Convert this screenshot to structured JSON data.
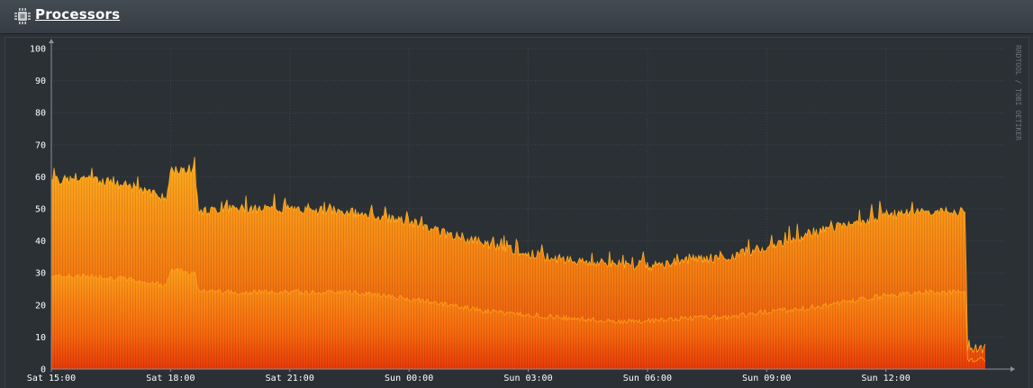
{
  "header": {
    "title": "Processors",
    "icon": "cpu-chip-icon"
  },
  "colors": {
    "background": "#2b3035",
    "band_low": "#ffa31a",
    "band_mid": "#f07010",
    "band_base": "#e8400a",
    "edge": "#ffb020",
    "axis_text": "#ffffff",
    "watermark": "#6b727a"
  },
  "chart_data": {
    "type": "area",
    "watermark": "RRDTOOL / TOBI OETIKER",
    "ylim": [
      0,
      100
    ],
    "yticks": [
      0,
      10,
      20,
      30,
      40,
      50,
      60,
      70,
      80,
      90,
      100
    ],
    "xtick_labels": [
      "Sat 15:00",
      "Sat 18:00",
      "Sat 21:00",
      "Sun 00:00",
      "Sun 03:00",
      "Sun 06:00",
      "Sun 09:00",
      "Sun 12:00"
    ],
    "x_hours": [
      0,
      3,
      6,
      9,
      12,
      15,
      18,
      21
    ],
    "xlim_hours": [
      0,
      24
    ],
    "series_total": {
      "x": [
        0,
        1.0,
        2.0,
        2.9,
        3.0,
        3.6,
        3.7,
        4.5,
        6.0,
        7.5,
        9.0,
        10.0,
        11.0,
        12.0,
        13.0,
        14.0,
        15.0,
        16.0,
        17.0,
        18.0,
        19.0,
        20.0,
        21.0,
        22.0,
        23.0,
        23.05,
        23.1,
        24.0
      ],
      "y": [
        59,
        59,
        57,
        53,
        62,
        62,
        49,
        50,
        50,
        49,
        46,
        42,
        39,
        36,
        34,
        33,
        32,
        34,
        35,
        38,
        42,
        45,
        48,
        49,
        49,
        6,
        6,
        6
      ]
    },
    "series_user": {
      "x": [
        0,
        1.0,
        2.0,
        2.9,
        3.0,
        3.6,
        3.7,
        4.5,
        6.0,
        7.5,
        9.0,
        10.0,
        11.0,
        12.0,
        13.0,
        14.0,
        15.0,
        16.0,
        17.0,
        18.0,
        19.0,
        20.0,
        21.0,
        22.0,
        23.0,
        23.05,
        23.1,
        24.0
      ],
      "y": [
        29,
        29,
        28,
        26,
        31,
        30,
        25,
        24,
        24,
        24,
        22,
        20,
        18,
        17,
        16,
        15,
        15,
        16,
        16,
        18,
        19,
        21,
        23,
        24,
        24,
        3,
        3,
        3
      ]
    },
    "data_end_hour": 23.5
  }
}
